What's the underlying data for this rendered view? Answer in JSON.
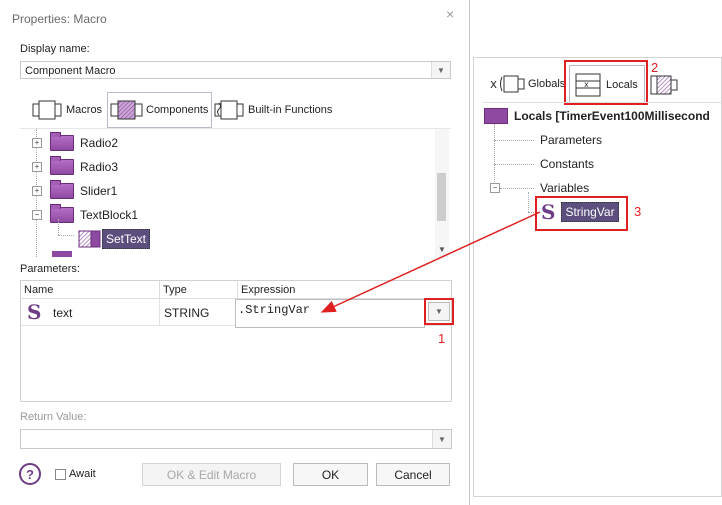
{
  "dialog": {
    "title": "Properties: Macro",
    "close": "×",
    "display_name_label": "Display name:",
    "display_name_value": "Component Macro",
    "tabs": [
      {
        "label": "Macros",
        "icon": "macros-icon"
      },
      {
        "label": "Components",
        "icon": "components-icon"
      },
      {
        "label": "Built-in Functions",
        "icon": "builtin-functions-icon"
      }
    ],
    "tree": [
      {
        "label": "Radio2",
        "expander": "+"
      },
      {
        "label": "Radio3",
        "expander": "+"
      },
      {
        "label": "Slider1",
        "expander": "+"
      },
      {
        "label": "TextBlock1",
        "expander": "−"
      },
      {
        "label": "SetText",
        "selected": true
      }
    ],
    "parameters_label": "Parameters:",
    "grid_headers": [
      "Name",
      "Type",
      "Expression"
    ],
    "grid_row": {
      "name": "text",
      "type": "STRING",
      "expression": ".StringVar"
    },
    "return_value_label": "Return Value:",
    "await_label": "Await",
    "ok_edit_label": "OK & Edit Macro",
    "ok_label": "OK",
    "cancel_label": "Cancel",
    "help_symbol": "?"
  },
  "panel": {
    "tabs": [
      {
        "label": "Globals",
        "icon": "globals-icon"
      },
      {
        "label": "Locals",
        "icon": "locals-icon"
      }
    ],
    "root_label": "Locals [TimerEvent100Millisecond",
    "items": [
      "Parameters",
      "Constants",
      "Variables"
    ],
    "variable": "StringVar"
  },
  "annotations": {
    "one": "1",
    "two": "2",
    "three": "3"
  },
  "colors": {
    "accent": "#6e3c85",
    "annotation_red": "#e02020",
    "selection_bg": "#5c4f7e"
  }
}
